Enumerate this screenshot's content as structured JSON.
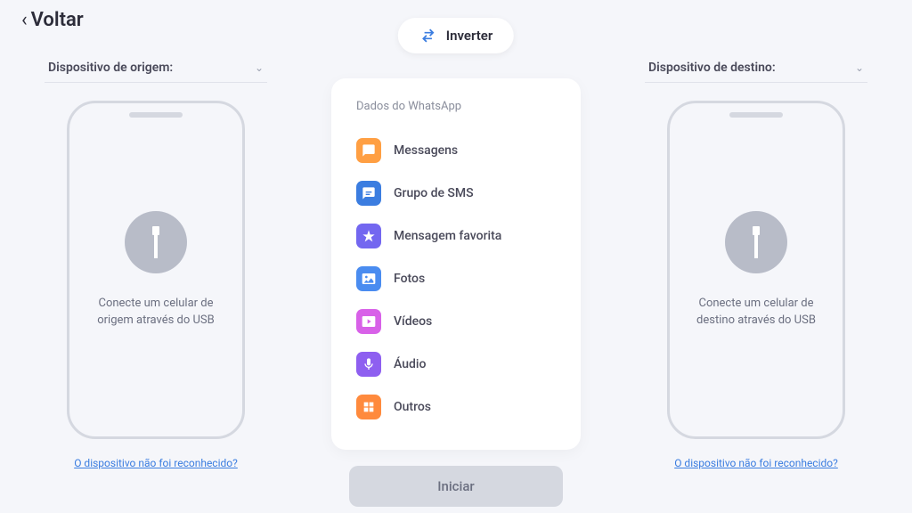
{
  "header": {
    "back_label": "Voltar",
    "invert_label": "Inverter"
  },
  "source": {
    "label": "Dispositivo de origem:",
    "phone_text": "Conecte um celular de origem através do USB",
    "help_link": "O dispositivo não foi reconhecido?"
  },
  "destination": {
    "label": "Dispositivo de destino:",
    "phone_text": "Conecte um celular de destino através do USB",
    "help_link": "O dispositivo não foi reconhecido?"
  },
  "data_panel": {
    "title": "Dados do WhatsApp",
    "items": [
      {
        "label": "Messagens",
        "color": "ic-orange"
      },
      {
        "label": "Grupo de SMS",
        "color": "ic-blue"
      },
      {
        "label": "Mensagem favorita",
        "color": "ic-purple"
      },
      {
        "label": "Fotos",
        "color": "ic-lightblue"
      },
      {
        "label": "Vídeos",
        "color": "ic-pink"
      },
      {
        "label": "Áudio",
        "color": "ic-violet"
      },
      {
        "label": "Outros",
        "color": "ic-orange2"
      }
    ]
  },
  "start_label": "Iniciar"
}
